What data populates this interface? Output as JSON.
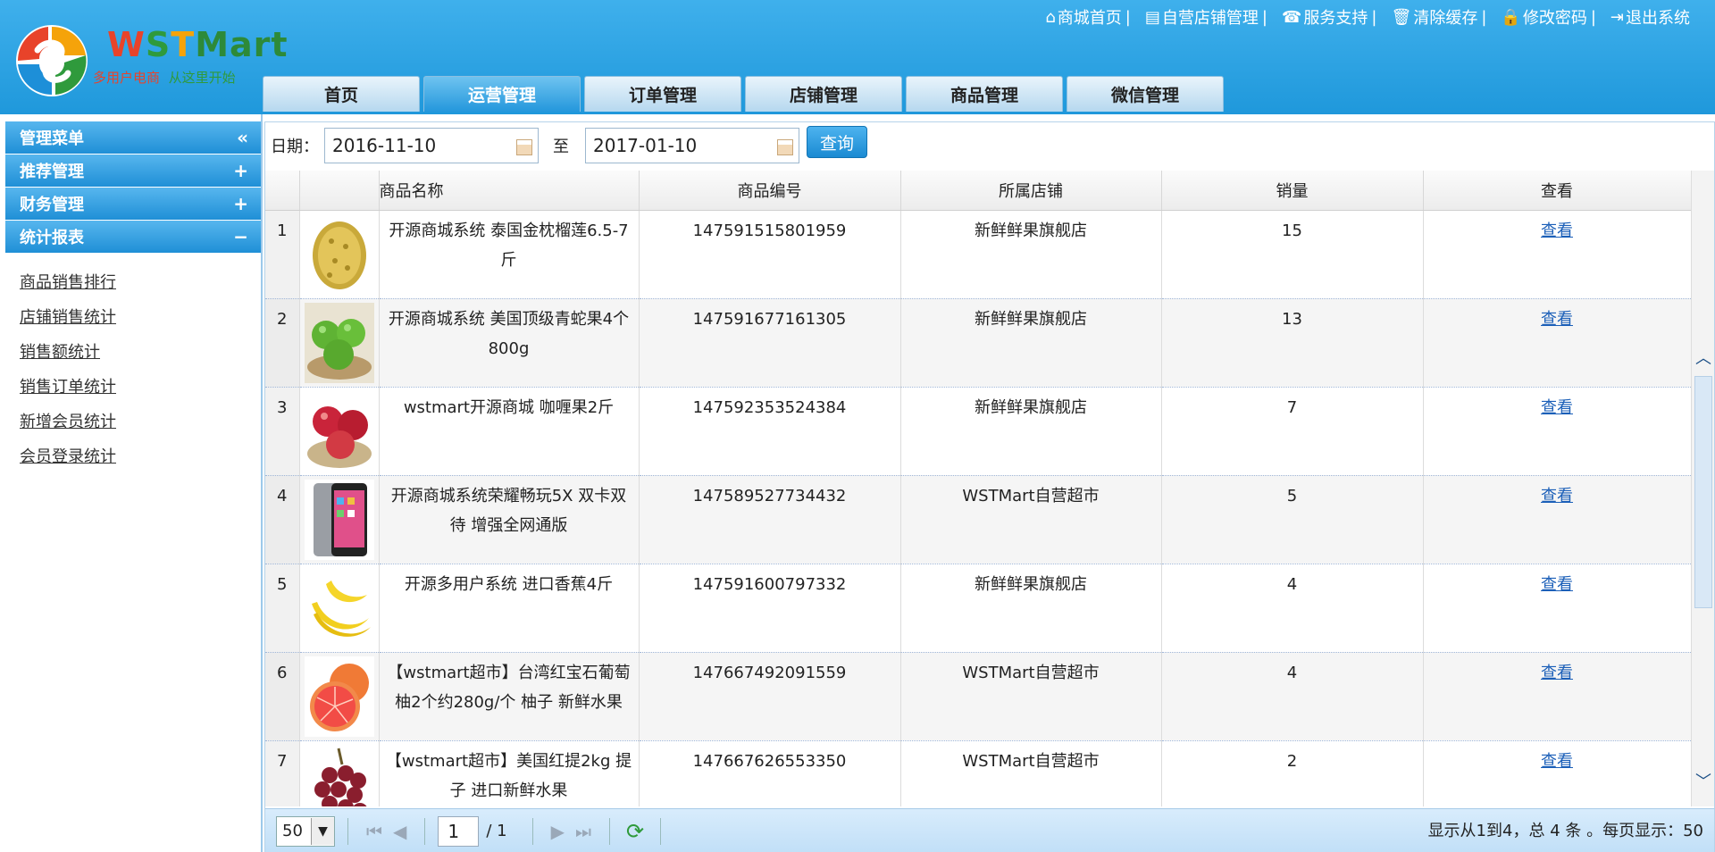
{
  "logo": {
    "w": "W",
    "s": "S",
    "t": "T",
    "rest": "Mart",
    "slogan_a": "多用户电商",
    "slogan_b": "从这里开始"
  },
  "topnav": [
    {
      "icon": "home-icon",
      "label": "商城首页"
    },
    {
      "icon": "store-icon",
      "label": "自营店铺管理"
    },
    {
      "icon": "support-icon",
      "label": "服务支持"
    },
    {
      "icon": "trash-icon",
      "label": "清除缓存"
    },
    {
      "icon": "lock-icon",
      "label": "修改密码"
    },
    {
      "icon": "logout-icon",
      "label": "退出系统"
    }
  ],
  "tabs": [
    "首页",
    "运营管理",
    "订单管理",
    "店铺管理",
    "商品管理",
    "微信管理"
  ],
  "active_tab": 1,
  "sidebar": {
    "sections": [
      {
        "label": "管理菜单",
        "symbol": "«"
      },
      {
        "label": "推荐管理",
        "symbol": "+"
      },
      {
        "label": "财务管理",
        "symbol": "+"
      },
      {
        "label": "统计报表",
        "symbol": "−"
      }
    ],
    "links": [
      "商品销售排行",
      "店铺销售统计",
      "销售额统计",
      "销售订单统计",
      "新增会员统计",
      "会员登录统计"
    ]
  },
  "filter": {
    "label": "日期：",
    "start_date": "2016-11-10",
    "to": "至",
    "end_date": "2017-01-10",
    "query_button": "查询"
  },
  "table": {
    "headers": [
      "商品名称",
      "商品编号",
      "所属店铺",
      "销量",
      "查看"
    ],
    "rows": [
      {
        "idx": "1",
        "name": "开源商城系统 泰国金枕榴莲6.5-7斤",
        "code": "147591515801959",
        "shop": "新鲜鲜果旗舰店",
        "sales": "15",
        "view": "查看",
        "thumb": "durian"
      },
      {
        "idx": "2",
        "name": "开源商城系统 美国顶级青蛇果4个800g",
        "code": "147591677161305",
        "shop": "新鲜鲜果旗舰店",
        "sales": "13",
        "view": "查看",
        "thumb": "green-apple"
      },
      {
        "idx": "3",
        "name": "wstmart开源商城 咖喱果2斤",
        "code": "147592353524384",
        "shop": "新鲜鲜果旗舰店",
        "sales": "7",
        "view": "查看",
        "thumb": "red-apple"
      },
      {
        "idx": "4",
        "name": "开源商城系统荣耀畅玩5X 双卡双待 增强全网通版",
        "code": "147589527734432",
        "shop": "WSTMart自营超市",
        "sales": "5",
        "view": "查看",
        "thumb": "phone"
      },
      {
        "idx": "5",
        "name": "开源多用户系统 进口香蕉4斤",
        "code": "147591600797332",
        "shop": "新鲜鲜果旗舰店",
        "sales": "4",
        "view": "查看",
        "thumb": "banana"
      },
      {
        "idx": "6",
        "name": "【wstmart超市】台湾红宝石葡萄柚2个约280g/个 柚子 新鲜水果",
        "code": "147667492091559",
        "shop": "WSTMart自营超市",
        "sales": "4",
        "view": "查看",
        "thumb": "grapefruit"
      },
      {
        "idx": "7",
        "name": "【wstmart超市】美国红提2kg 提子 进口新鲜水果",
        "code": "147667626553350",
        "shop": "WSTMart自营超市",
        "sales": "2",
        "view": "查看",
        "thumb": "grapes"
      }
    ]
  },
  "pager": {
    "page_size": "50",
    "page": "1",
    "total_pages": "/ 1",
    "info": "显示从1到4，总 4 条 。每页显示：50"
  }
}
